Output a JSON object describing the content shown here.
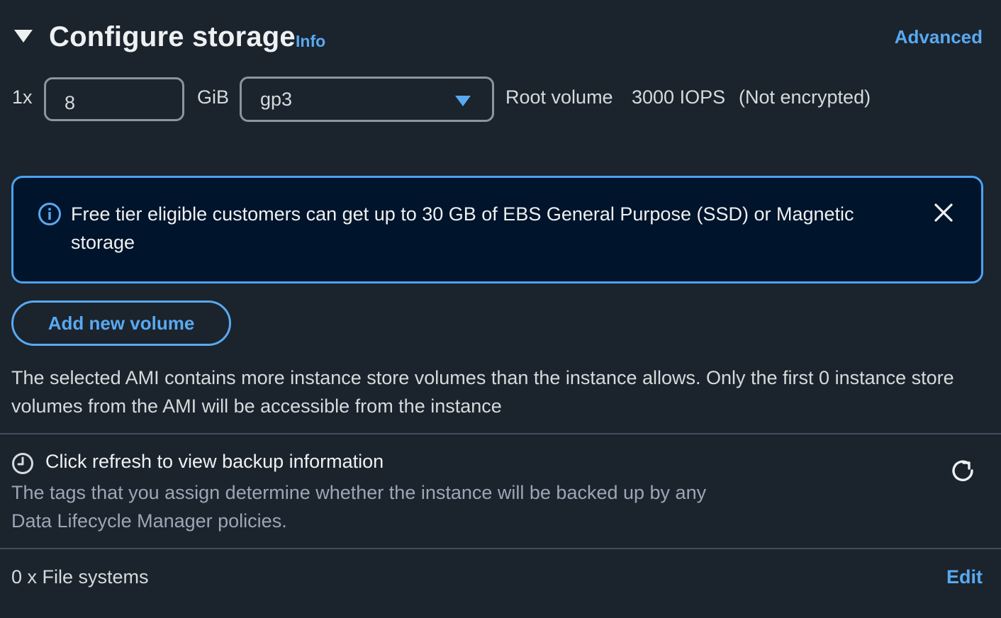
{
  "header": {
    "title": "Configure storage",
    "info_label": "Info",
    "advanced_label": "Advanced"
  },
  "volume": {
    "count_label": "1x",
    "size_value": "8",
    "unit_label": "GiB",
    "type_value": "gp3",
    "root_label": "Root volume",
    "iops_label": "3000 IOPS",
    "encryption_label": "(Not encrypted)"
  },
  "alert": {
    "message": "Free tier eligible customers can get up to 30 GB of EBS General Purpose (SSD) or Magnetic storage"
  },
  "add_volume_label": "Add new volume",
  "warning_text": "The selected AMI contains more instance store volumes than the instance allows. Only the first 0 instance store volumes from the AMI will be accessible from the instance",
  "backup": {
    "title": "Click refresh to view backup information",
    "description": "The tags that you assign determine whether the instance will be backed up by any Data Lifecycle Manager policies."
  },
  "file_systems": {
    "label": "0 x File systems",
    "edit_label": "Edit"
  },
  "colors": {
    "background": "#1b232d",
    "accent": "#59a9f0",
    "alert_background": "#00142b"
  }
}
